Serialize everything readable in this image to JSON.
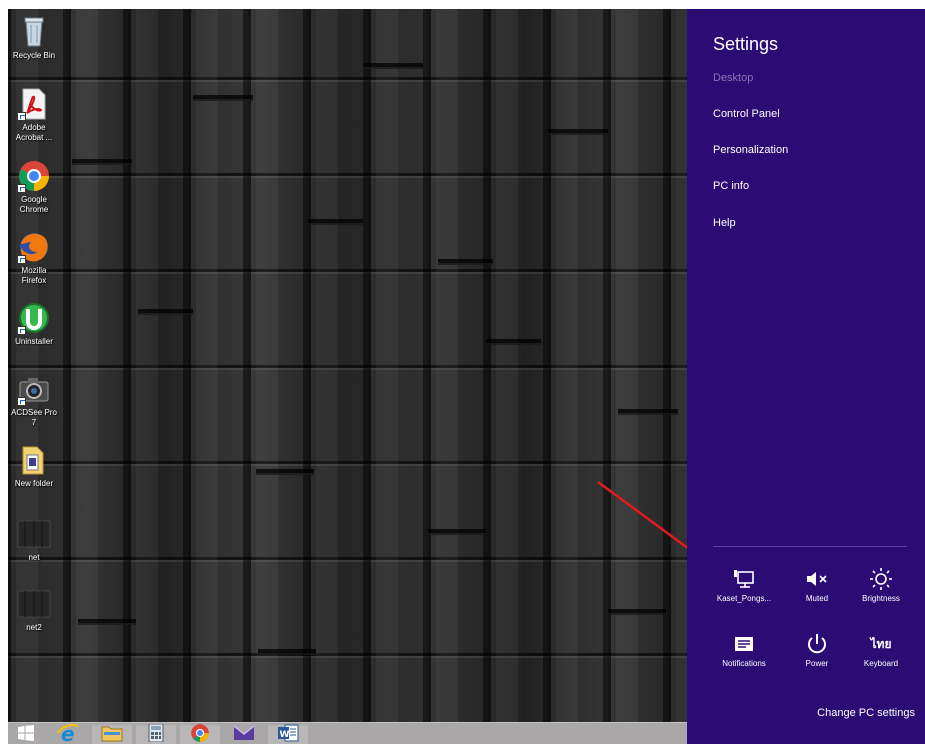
{
  "desktop": {
    "icons": [
      {
        "label": "Recycle Bin",
        "icon": "recycle-bin-icon"
      },
      {
        "label": "Adobe Acrobat ...",
        "icon": "adobe-acrobat-icon"
      },
      {
        "label": "Google Chrome",
        "icon": "chrome-icon"
      },
      {
        "label": "Mozilla Firefox",
        "icon": "firefox-icon"
      },
      {
        "label": "Uninstaller",
        "icon": "uninstaller-icon"
      },
      {
        "label": "ACDSee Pro 7",
        "icon": "camera-icon"
      },
      {
        "label": "New folder",
        "icon": "folder-icon"
      },
      {
        "label": "net",
        "icon": "image-thumbnail-icon"
      },
      {
        "label": "net2",
        "icon": "image-thumbnail-icon"
      }
    ]
  },
  "taskbar": {
    "items": [
      "start-icon",
      "internet-explorer-icon",
      "file-explorer-icon",
      "calculator-icon",
      "chrome-icon",
      "mail-icon",
      "word-icon"
    ]
  },
  "settings": {
    "title": "Settings",
    "context": "Desktop",
    "items": [
      "Control Panel",
      "Personalization",
      "PC info",
      "Help"
    ],
    "tiles": [
      {
        "label": "Kaset_Pongs...",
        "icon": "network-icon"
      },
      {
        "label": "Muted",
        "icon": "speaker-muted-icon"
      },
      {
        "label": "Brightness",
        "icon": "brightness-icon"
      },
      {
        "label": "Notifications",
        "icon": "notifications-icon"
      },
      {
        "label": "Power",
        "icon": "power-icon"
      },
      {
        "label": "Keyboard",
        "icon": "keyboard-language-icon",
        "glyph": "ไทย"
      }
    ],
    "change_pc_settings": "Change PC settings"
  },
  "colors": {
    "pane_bg": "#2b0c74",
    "disabled_text": "#8677b4",
    "arrow": "#e21b1b",
    "taskbar": "#a9a7a7"
  }
}
